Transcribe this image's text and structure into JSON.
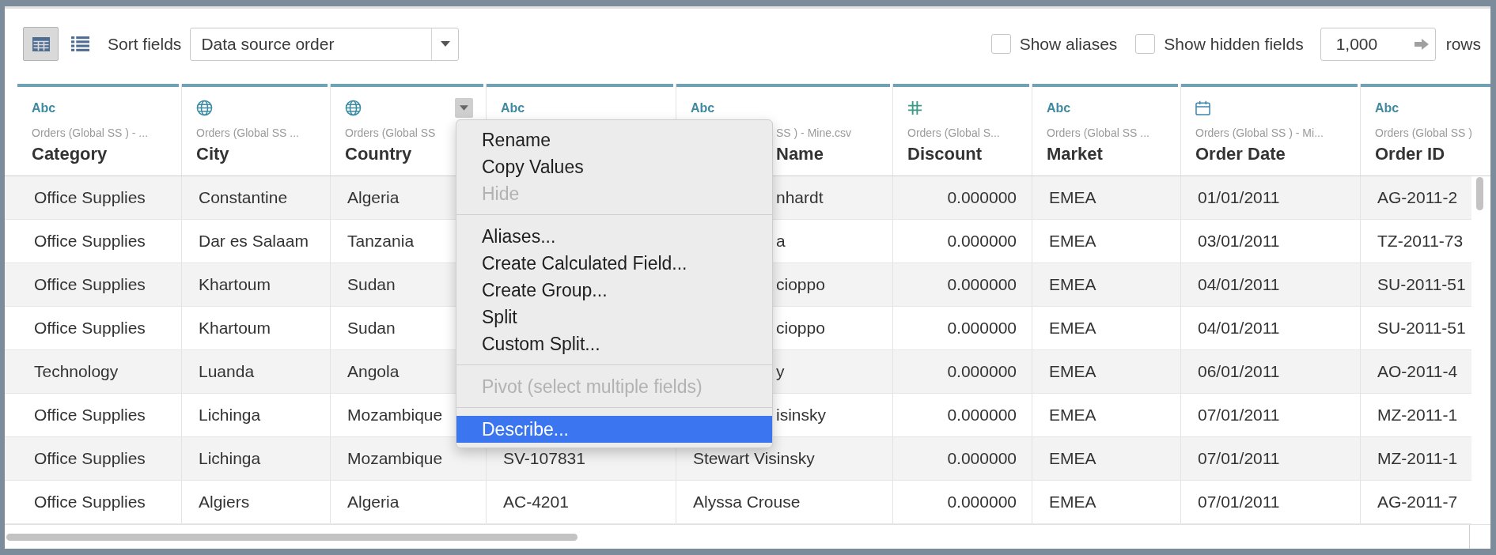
{
  "toolbar": {
    "views": [
      {
        "kind": "grid",
        "selected": true
      },
      {
        "kind": "list",
        "selected": false
      }
    ],
    "sort_label": "Sort fields",
    "sort_dropdown": {
      "value": "Data source order"
    },
    "checkboxes": [
      {
        "label": "Show aliases",
        "checked": false
      },
      {
        "label": "Show hidden fields",
        "checked": false
      }
    ],
    "row_limit": {
      "value": "1,000"
    },
    "row_limit_unit": "rows"
  },
  "table": {
    "columns": [
      {
        "kind": "string",
        "type_label": "Abc",
        "source": "Orders (Global SS ) - ...",
        "name": "Category",
        "menu_open": false
      },
      {
        "kind": "geo",
        "source": "Orders (Global SS ...",
        "name": "City",
        "menu_open": false
      },
      {
        "kind": "geo",
        "source": "Orders (Global SS",
        "name": "Country",
        "menu_open": true
      },
      {
        "kind": "string",
        "type_label": "Abc",
        "menu_open": false
      },
      {
        "kind": "string",
        "type_label": "Abc",
        "source": "SS ) - Mine.csv",
        "name": "Name",
        "menu_open": false
      },
      {
        "kind": "number",
        "source": "Orders (Global S...",
        "name": "Discount",
        "menu_open": false
      },
      {
        "kind": "string",
        "type_label": "Abc",
        "source": "Orders (Global SS ...",
        "name": "Market",
        "menu_open": false
      },
      {
        "kind": "date",
        "source": "Orders (Global SS ) - Mi...",
        "name": "Order Date",
        "menu_open": false
      },
      {
        "kind": "string",
        "type_label": "Abc",
        "source": "Orders (Global SS )",
        "name": "Order ID",
        "menu_open": false
      }
    ],
    "rows": [
      {
        "cells": [
          "Office Supplies",
          "Constantine",
          "Algeria",
          null,
          "nhardt",
          "0.000000",
          "EMEA",
          "01/01/2011",
          "AG-2011-2"
        ]
      },
      {
        "cells": [
          "Office Supplies",
          "Dar es Salaam",
          "Tanzania",
          null,
          "a",
          "0.000000",
          "EMEA",
          "03/01/2011",
          "TZ-2011-73"
        ]
      },
      {
        "cells": [
          "Office Supplies",
          "Khartoum",
          "Sudan",
          null,
          "cioppo",
          "0.000000",
          "EMEA",
          "04/01/2011",
          "SU-2011-51"
        ]
      },
      {
        "cells": [
          "Office Supplies",
          "Khartoum",
          "Sudan",
          null,
          "cioppo",
          "0.000000",
          "EMEA",
          "04/01/2011",
          "SU-2011-51"
        ]
      },
      {
        "cells": [
          "Technology",
          "Luanda",
          "Angola",
          null,
          "y",
          "0.000000",
          "EMEA",
          "06/01/2011",
          "AO-2011-4"
        ]
      },
      {
        "cells": [
          "Office Supplies",
          "Lichinga",
          "Mozambique",
          null,
          "isinsky",
          "0.000000",
          "EMEA",
          "07/01/2011",
          "MZ-2011-1"
        ]
      },
      {
        "cells": [
          "Office Supplies",
          "Lichinga",
          "Mozambique",
          "SV-107831",
          "Stewart Visinsky",
          "0.000000",
          "EMEA",
          "07/01/2011",
          "MZ-2011-1"
        ]
      },
      {
        "cells": [
          "Office Supplies",
          "Algiers",
          "Algeria",
          "AC-4201",
          "Alyssa Crouse",
          "0.000000",
          "EMEA",
          "07/01/2011",
          "AG-2011-7"
        ]
      }
    ]
  },
  "context_menu": {
    "groups": [
      {
        "items": [
          {
            "label": "Rename",
            "disabled": false,
            "selected": false
          },
          {
            "label": "Copy Values",
            "disabled": false,
            "selected": false
          },
          {
            "label": "Hide",
            "disabled": true,
            "selected": false
          }
        ]
      },
      {
        "items": [
          {
            "label": "Aliases...",
            "disabled": false,
            "selected": false
          },
          {
            "label": "Create Calculated Field...",
            "disabled": false,
            "selected": false
          },
          {
            "label": "Create Group...",
            "disabled": false,
            "selected": false
          },
          {
            "label": "Split",
            "disabled": false,
            "selected": false
          },
          {
            "label": "Custom Split...",
            "disabled": false,
            "selected": false
          }
        ]
      },
      {
        "items": [
          {
            "label": "Pivot (select multiple fields)",
            "disabled": true,
            "selected": false
          }
        ]
      },
      {
        "items": [
          {
            "label": "Describe...",
            "disabled": false,
            "selected": true
          }
        ]
      }
    ]
  }
}
